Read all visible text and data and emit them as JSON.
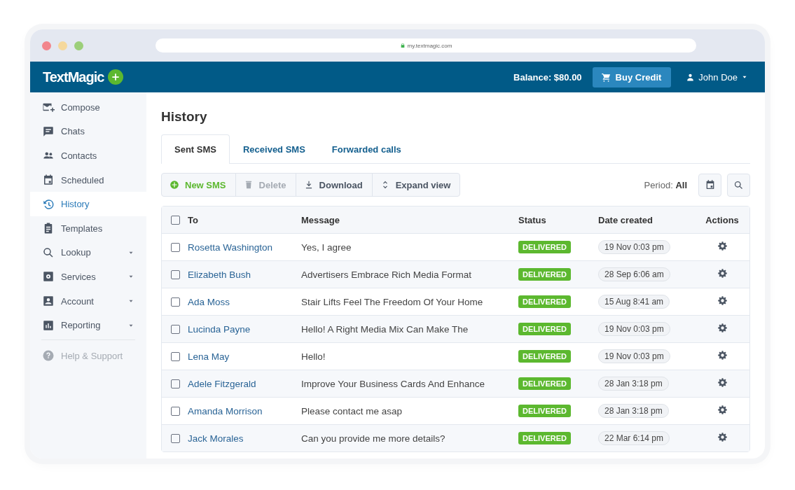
{
  "browser": {
    "url": "my.textmagic.com"
  },
  "header": {
    "logo": "TextMagic",
    "balance": "Balance: $80.00",
    "buy_button": "Buy Credit",
    "user": "John Doe"
  },
  "sidebar": {
    "items": [
      {
        "label": "Compose",
        "selected": false,
        "dropdown": false,
        "disabled": false
      },
      {
        "label": "Chats",
        "selected": false,
        "dropdown": false,
        "disabled": false
      },
      {
        "label": "Contacts",
        "selected": false,
        "dropdown": false,
        "disabled": false
      },
      {
        "label": "Scheduled",
        "selected": false,
        "dropdown": false,
        "disabled": false
      },
      {
        "label": "History",
        "selected": true,
        "dropdown": false,
        "disabled": false
      },
      {
        "label": "Templates",
        "selected": false,
        "dropdown": false,
        "disabled": false
      },
      {
        "label": "Lookup",
        "selected": false,
        "dropdown": true,
        "disabled": false
      },
      {
        "label": "Services",
        "selected": false,
        "dropdown": true,
        "disabled": false
      },
      {
        "label": "Account",
        "selected": false,
        "dropdown": true,
        "disabled": false
      },
      {
        "label": "Reporting",
        "selected": false,
        "dropdown": true,
        "disabled": false
      },
      {
        "label": "Help & Support",
        "selected": false,
        "dropdown": false,
        "disabled": true
      }
    ]
  },
  "page_title": "History",
  "tabs": [
    {
      "label": "Sent SMS",
      "selected": true
    },
    {
      "label": "Received SMS",
      "selected": false
    },
    {
      "label": "Forwarded calls",
      "selected": false
    }
  ],
  "toolbar": {
    "buttons": [
      {
        "label": "New SMS",
        "kind": "primary",
        "disabled": false
      },
      {
        "label": "Delete",
        "kind": "delete",
        "disabled": true
      },
      {
        "label": "Download",
        "kind": "download",
        "disabled": false
      },
      {
        "label": "Expand view",
        "kind": "expand",
        "disabled": false
      }
    ],
    "period_label": "Period:",
    "period_value": "All"
  },
  "table": {
    "columns": [
      "To",
      "Message",
      "Status",
      "Date created",
      "Actions"
    ],
    "header_checked": false,
    "rows": [
      {
        "to": "Rosetta Washington",
        "message": "Yes, I agree",
        "status": "DELIVERED",
        "date": "19 Nov 0:03 pm",
        "checked": false
      },
      {
        "to": "Elizabeth Bush",
        "message": "Advertisers Embrace Rich Media Format",
        "status": "DELIVERED",
        "date": "28 Sep 6:06 am",
        "checked": false
      },
      {
        "to": "Ada Moss",
        "message": "Stair Lifts Feel The Freedom Of Your Home",
        "status": "DELIVERED",
        "date": "15 Aug 8:41 am",
        "checked": false
      },
      {
        "to": "Lucinda Payne",
        "message": "Hello! A Right Media Mix Can Make The",
        "status": "DELIVERED",
        "date": "19 Nov 0:03 pm",
        "checked": false
      },
      {
        "to": "Lena May",
        "message": "Hello!",
        "status": "DELIVERED",
        "date": "19 Nov 0:03 pm",
        "checked": false
      },
      {
        "to": "Adele Fitzgerald",
        "message": "Improve Your Business Cards And Enhance",
        "status": "DELIVERED",
        "date": "28 Jan 3:18 pm",
        "checked": false
      },
      {
        "to": "Amanda Morrison",
        "message": "Please contact me asap",
        "status": "DELIVERED",
        "date": "28 Jan 3:18 pm",
        "checked": false
      },
      {
        "to": "Jack Morales",
        "message": "Can you provide me more details?",
        "status": "DELIVERED",
        "date": "22 Mar 6:14 pm",
        "checked": false
      }
    ]
  }
}
